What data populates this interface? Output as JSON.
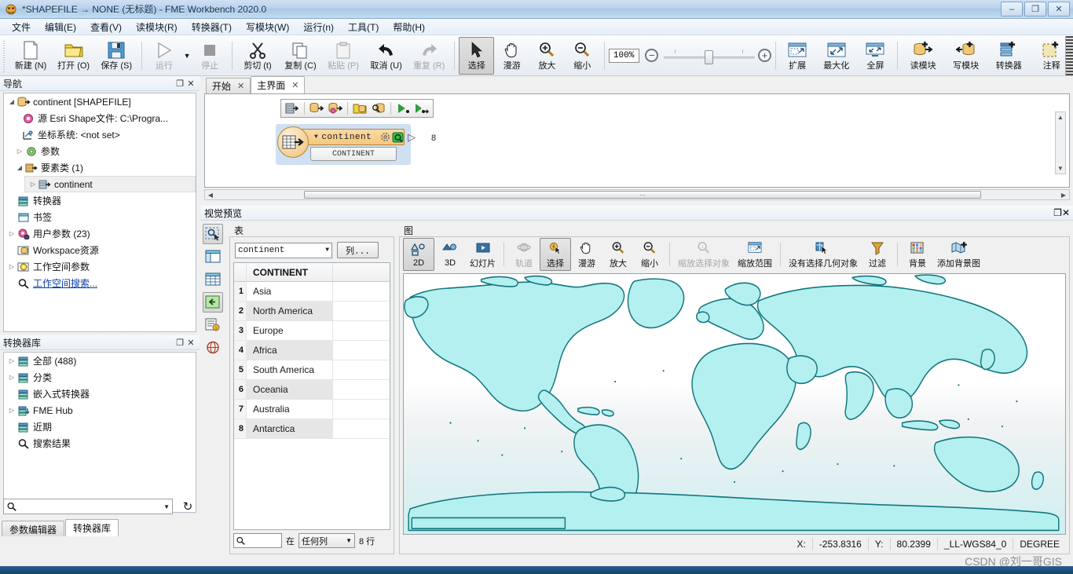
{
  "window": {
    "title": "*SHAPEFILE → NONE (无标题) - FME Workbench 2020.0",
    "minimize": "–",
    "restore": "❐",
    "close": "✕"
  },
  "menu": {
    "items": [
      {
        "label": "文件"
      },
      {
        "label": "编辑(E)"
      },
      {
        "label": "查看(V)"
      },
      {
        "label": "读模块(R)"
      },
      {
        "label": "转换器(T)"
      },
      {
        "label": "写模块(W)"
      },
      {
        "label": "运行(n)"
      },
      {
        "label": "工具(T)"
      },
      {
        "label": "帮助(H)"
      }
    ]
  },
  "toolbar": {
    "items": [
      {
        "label": "新建 (N)",
        "icon": "new-file-icon",
        "enabled": true
      },
      {
        "label": "打开 (O)",
        "icon": "open-folder-icon",
        "enabled": true
      },
      {
        "label": "保存 (S)",
        "icon": "save-disk-icon",
        "enabled": true
      },
      {
        "label": "运行",
        "icon": "run-play-icon",
        "enabled": false
      },
      {
        "label": "停止",
        "icon": "stop-square-icon",
        "enabled": false
      },
      {
        "label": "剪切 (t)",
        "icon": "scissors-icon",
        "enabled": true
      },
      {
        "label": "复制 (C)",
        "icon": "copy-icon",
        "enabled": true
      },
      {
        "label": "粘贴 (P)",
        "icon": "paste-icon",
        "enabled": false
      },
      {
        "label": "取消 (U)",
        "icon": "undo-arrow-icon",
        "enabled": true
      },
      {
        "label": "重复 (R)",
        "icon": "redo-arrow-icon",
        "enabled": false
      },
      {
        "label": "选择",
        "icon": "pointer-arrow-icon",
        "enabled": true,
        "active": true
      },
      {
        "label": "漫游",
        "icon": "hand-pan-icon",
        "enabled": true
      },
      {
        "label": "放大",
        "icon": "zoom-in-icon",
        "enabled": true
      },
      {
        "label": "缩小",
        "icon": "zoom-out-icon",
        "enabled": true
      },
      {
        "label": "扩展",
        "icon": "expand-window-icon",
        "enabled": true
      },
      {
        "label": "最大化",
        "icon": "maximize-window-icon",
        "enabled": true
      },
      {
        "label": "全屏",
        "icon": "fullscreen-icon",
        "enabled": true
      },
      {
        "label": "读模块",
        "icon": "add-reader-icon",
        "enabled": true
      },
      {
        "label": "写模块",
        "icon": "add-writer-icon",
        "enabled": true
      },
      {
        "label": "转换器",
        "icon": "add-transformer-icon",
        "enabled": true
      },
      {
        "label": "注释",
        "icon": "add-annotation-icon",
        "enabled": true
      }
    ],
    "zoom_value": "100%",
    "zoom_out_glyph": "−",
    "zoom_in_glyph": "+"
  },
  "navigation": {
    "title": "导航",
    "tree": [
      {
        "label": "continent [SHAPEFILE]",
        "icon": "reader-icon",
        "arrow": "◢",
        "indent": 0
      },
      {
        "label": "源 Esri Shape文件: C:\\Progra...",
        "icon": "source-gear-icon",
        "arrow": "",
        "indent": 1
      },
      {
        "label": "坐标系统: <not set>",
        "icon": "coordsys-icon",
        "arrow": "",
        "indent": 1
      },
      {
        "label": "参数",
        "icon": "gear-icon",
        "arrow": "▷",
        "indent": 1
      },
      {
        "label": "要素类 (1)",
        "icon": "featuretype-icon",
        "arrow": "◢",
        "indent": 1
      },
      {
        "label": "continent",
        "icon": "feature-icon",
        "arrow": "▷",
        "indent": 2,
        "selected": true
      },
      {
        "label": "转换器",
        "icon": "transformer-icon",
        "arrow": "",
        "indent": 0
      },
      {
        "label": "书签",
        "icon": "bookmark-icon",
        "arrow": "",
        "indent": 0
      },
      {
        "label": "用户参数 (23)",
        "icon": "userparam-icon",
        "arrow": "▷",
        "indent": 0
      },
      {
        "label": "Workspace资源",
        "icon": "resource-icon",
        "arrow": "",
        "indent": 0
      },
      {
        "label": "工作空间参数",
        "icon": "wsparam-icon",
        "arrow": "▷",
        "indent": 0
      },
      {
        "label": "工作空间搜索...",
        "icon": "search-icon",
        "arrow": "",
        "indent": 0,
        "link": true
      }
    ]
  },
  "gallery": {
    "title": "转换器库",
    "items": [
      {
        "label": "全部 (488)",
        "icon": "transformer-icon",
        "arrow": "▷"
      },
      {
        "label": "分类",
        "icon": "transformer-icon",
        "arrow": "▷"
      },
      {
        "label": "嵌入式转换器",
        "icon": "transformer-icon",
        "arrow": ""
      },
      {
        "label": "FME Hub",
        "icon": "transformer-hub-icon",
        "arrow": "▷"
      },
      {
        "label": "近期",
        "icon": "transformer-icon",
        "arrow": ""
      },
      {
        "label": "搜索结果",
        "icon": "search-icon",
        "arrow": ""
      }
    ],
    "search_value": "",
    "search_placeholder": "",
    "refresh_glyph": "↻",
    "tabs": [
      {
        "label": "参数编辑器",
        "active": false
      },
      {
        "label": "转换器库",
        "active": true
      }
    ]
  },
  "canvas": {
    "tabs": [
      {
        "label": "开始",
        "close": "✕",
        "active": false
      },
      {
        "label": "主界面",
        "close": "✕",
        "active": true
      }
    ],
    "mini_toolbar": [
      {
        "icon": "featuretype-add-icon"
      },
      {
        "icon": "reader-add-icon"
      },
      {
        "icon": "reader-params-icon"
      },
      {
        "icon": "folder-db-icon"
      },
      {
        "icon": "inspect-db-icon"
      },
      {
        "icon": "run-to-icon"
      },
      {
        "icon": "run-from-icon"
      }
    ],
    "node": {
      "name": "continent",
      "attribute": "CONTINENT",
      "collapse_glyph": "▼",
      "gear_icon": "gear-icon",
      "inspect_icon": "inspect-icon",
      "port_glyph": "▷",
      "output_count": "8"
    }
  },
  "preview": {
    "title": "视觉预览",
    "side_tools": [
      {
        "icon": "inspect-select-icon",
        "active": true
      },
      {
        "icon": "layout-panel-icon",
        "active": false
      },
      {
        "icon": "table-grid-icon",
        "active": false
      },
      {
        "icon": "feature-info-icon",
        "active": true
      },
      {
        "icon": "info-list-icon",
        "active": false
      },
      {
        "icon": "coordsys-globe-icon",
        "active": false
      }
    ],
    "table": {
      "label": "表",
      "dataset_value": "continent",
      "dataset_arrow": "▼",
      "columns_button": "列...",
      "column_header": "CONTINENT",
      "rows": [
        {
          "n": "1",
          "value": "Asia"
        },
        {
          "n": "2",
          "value": "North America"
        },
        {
          "n": "3",
          "value": "Europe"
        },
        {
          "n": "4",
          "value": "Africa"
        },
        {
          "n": "5",
          "value": "South America"
        },
        {
          "n": "6",
          "value": "Oceania"
        },
        {
          "n": "7",
          "value": "Australia"
        },
        {
          "n": "8",
          "value": "Antarctica"
        }
      ],
      "search_value": "",
      "search_icon": "search-icon",
      "in_label": "在",
      "scope_value": "任何列",
      "scope_arrow": "▼",
      "row_count": "8 行"
    },
    "graph": {
      "label": "图",
      "tools": [
        {
          "label": "2D",
          "icon": "view-2d-icon",
          "enabled": true,
          "active": true
        },
        {
          "label": "3D",
          "icon": "view-3d-icon",
          "enabled": true,
          "active": false
        },
        {
          "label": "幻灯片",
          "icon": "slideshow-icon",
          "enabled": true,
          "active": false
        },
        {
          "label": "轨道",
          "icon": "orbit-icon",
          "enabled": false,
          "active": false
        },
        {
          "label": "选择",
          "icon": "select-cursor-icon",
          "enabled": true,
          "active": true
        },
        {
          "label": "漫游",
          "icon": "hand-pan-icon",
          "enabled": true,
          "active": false
        },
        {
          "label": "放大",
          "icon": "zoom-in-icon",
          "enabled": true,
          "active": false
        },
        {
          "label": "缩小",
          "icon": "zoom-out-icon",
          "enabled": true,
          "active": false
        },
        {
          "label": "缩放选择对象",
          "icon": "zoom-selected-icon",
          "enabled": false,
          "active": false
        },
        {
          "label": "缩放范围",
          "icon": "zoom-extent-icon",
          "enabled": true,
          "active": false
        },
        {
          "label": "没有选择几何对象",
          "icon": "no-selection-icon",
          "enabled": true,
          "active": false
        },
        {
          "label": "过滤",
          "icon": "filter-funnel-icon",
          "enabled": true,
          "active": false
        },
        {
          "label": "背景",
          "icon": "background-palette-icon",
          "enabled": true,
          "active": false
        },
        {
          "label": "添加背景图",
          "icon": "add-basemap-icon",
          "enabled": true,
          "active": false
        }
      ],
      "status": {
        "x_label": "X:",
        "x_value": "-253.8316",
        "y_label": "Y:",
        "y_value": "80.2399",
        "coordsys": "_LL-WGS84_0",
        "units": "DEGREE"
      },
      "map_fill": "#b4f0f0",
      "map_stroke": "#12767d"
    }
  },
  "watermark": "CSDN @刘一哥GIS"
}
